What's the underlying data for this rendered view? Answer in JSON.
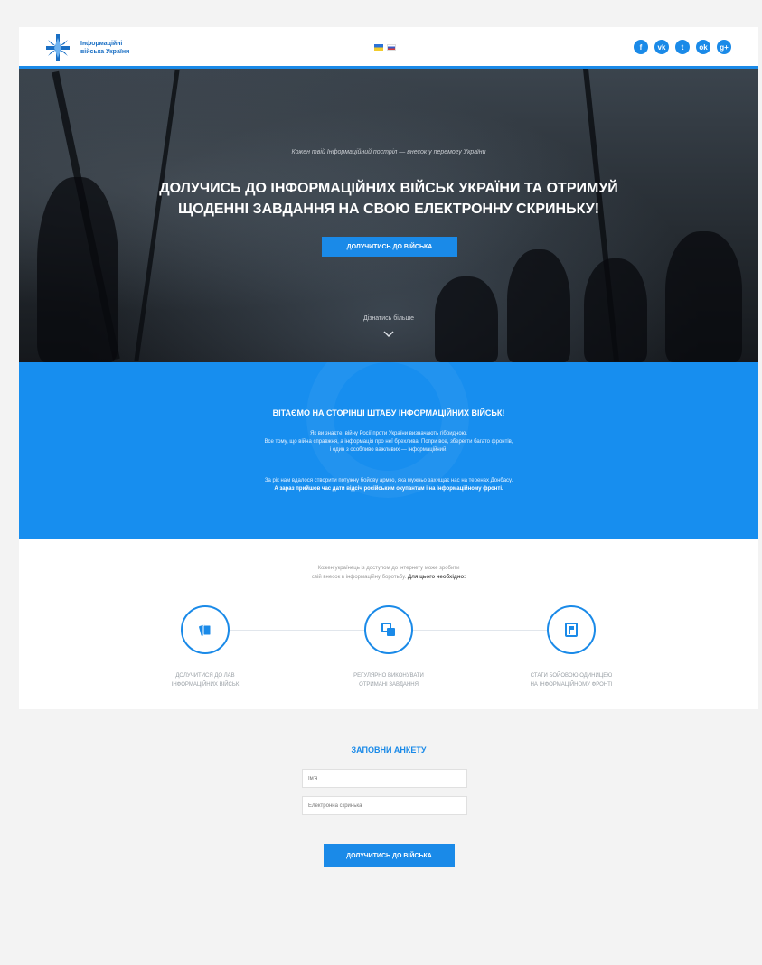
{
  "header": {
    "logo_line1": "Інформаційні",
    "logo_line2": "війська України",
    "languages": [
      "ua",
      "ru"
    ],
    "social": [
      {
        "icon": "facebook-icon",
        "glyph": "f"
      },
      {
        "icon": "vk-icon",
        "glyph": "vk"
      },
      {
        "icon": "twitter-icon",
        "glyph": "t"
      },
      {
        "icon": "odnoklassniki-icon",
        "glyph": "ok"
      },
      {
        "icon": "googleplus-icon",
        "glyph": "g+"
      }
    ]
  },
  "hero": {
    "caption": "Кожен твій Інформаційний постріл — внесок у перемогу України",
    "title_line1": "Долучись до інформаційних військ України та отримуй",
    "title_line2": "щоденні завдання на свою електронну скриньку!",
    "button": "Долучитись до війська",
    "more": "Дізнатись більше"
  },
  "welcome": {
    "title": "Вітаємо на сторінці штабу інформаційних військ!",
    "p1_line1": "Як ви знаєте, війну Росії проти України визначають гібридною.",
    "p1_line2": "Все тому, що війна справжня, а інформація про неї брехлива. Попри все, зберегти багато фронтів,",
    "p1_line3": "і один з особливо важливих — інформаційний.",
    "p2_line1": "За рік нам вдалося створити потужну бойову армію, яка мужньо захищає нас на теренах Донбасу.",
    "p2_line2": "А зараз прийшов час дати відсіч російським окупантам і на інформаційному фронті."
  },
  "steps": {
    "intro_line1": "Кожен українець із доступом до інтернету може зробити",
    "intro_line2": "свій внесок в інформаційну боротьбу.",
    "intro_bold": "Для цього необхідно:",
    "items": [
      {
        "icon": "cards-icon",
        "line1": "Долучитися до лав",
        "line2": "інформаційних військ"
      },
      {
        "icon": "tasks-icon",
        "line1": "Регулярно виконувати",
        "line2": "отримані завдання"
      },
      {
        "icon": "flag-icon",
        "line1": "Стати бойовою одиницею",
        "line2": "на інформаційному фронті"
      }
    ]
  },
  "form": {
    "title": "Заповни анкету",
    "name_placeholder": "Ім'я",
    "email_placeholder": "Електронна скринька",
    "button": "Долучитись до війська"
  },
  "colors": {
    "accent": "#1a8ae8",
    "welcome_bg": "#178eef",
    "form_bg": "#f3f3f3"
  }
}
